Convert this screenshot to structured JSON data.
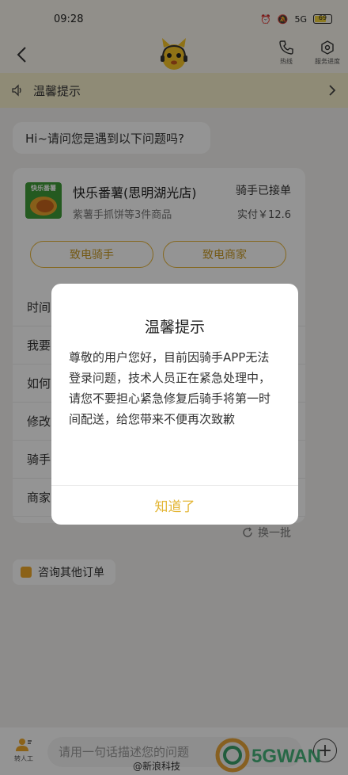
{
  "status_bar": {
    "time": "09:28",
    "battery_level": "69",
    "signal_text": "5G"
  },
  "header": {
    "back_icon": "chevron-left-icon",
    "hotline_label": "热线",
    "service_label": "服务进度"
  },
  "notice_bar": {
    "label": "温馨提示"
  },
  "chat": {
    "greeting": "Hi~请问您是遇到以下问题吗?"
  },
  "order_card": {
    "thumb_label": "快乐番薯",
    "shop_name": "快乐番薯(思明湖光店)",
    "items_text": "紫薯手抓饼等3件商品",
    "status": "骑手已接单",
    "paid": "实付￥12.6",
    "call_rider": "致电骑手",
    "call_merchant": "致电商家",
    "questions": [
      "时间",
      "我要",
      "如何",
      "修改",
      "骑手",
      "商家"
    ],
    "swap_label": "换一批"
  },
  "consult_other": "咨询其他订单",
  "bottom_bar": {
    "human_label": "转人工",
    "input_placeholder": "请用一句话描述您的问题"
  },
  "watermarks": {
    "weibo": "@新浪科技",
    "brand": "5GWAN"
  },
  "dialog": {
    "title": "温馨提示",
    "body": "尊敬的用户您好，目前因骑手APP无法登录问题，技术人员正在紧急处理中，请您不要担心紧急修复后骑手将第一时间配送，给您带来不便再次致歉",
    "confirm": "知道了"
  },
  "colors": {
    "accent": "#e3b533",
    "notice_bg": "#f7efcc",
    "thumb_green": "#3f9b37"
  }
}
